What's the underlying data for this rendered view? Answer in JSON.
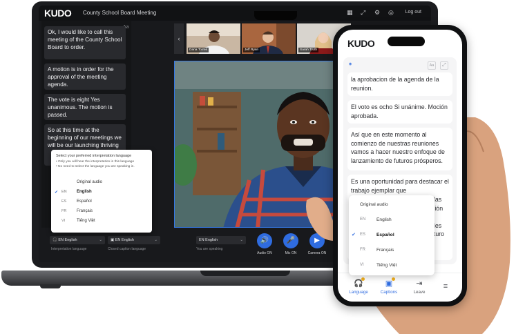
{
  "laptop": {
    "app_logo": "KUDO",
    "meeting_title": "County School Board Meeting",
    "logout": "Log out",
    "captions_font_button": "Aa",
    "captions": [
      "Ok, I would like to call this meeting of the County School Board to order.",
      "A motion is in order for the approval of the meeting agenda.",
      "The vote is eight Yes unanimous. The motion is passed.",
      "So at this time at the beginning of our meetings we will be our launching thriving"
    ],
    "language_popup": {
      "title": "Select your preferred interpretation language",
      "notes": [
        "• Only you will hear the interpretation in this language",
        "• No need to select the language you are speaking in."
      ],
      "options": [
        {
          "code": "",
          "name": "Original audio",
          "selected": false
        },
        {
          "code": "EN",
          "name": "English",
          "selected": true
        },
        {
          "code": "ES",
          "name": "Español",
          "selected": false
        },
        {
          "code": "FR",
          "name": "Français",
          "selected": false
        },
        {
          "code": "VI",
          "name": "Tiếng Việt",
          "selected": false
        }
      ]
    },
    "participants": [
      {
        "name": "Dana Torres"
      },
      {
        "name": "Jeff Ryan"
      },
      {
        "name": "Sarah Truth"
      }
    ],
    "controls": {
      "interpretation_value": "EN English",
      "interpretation_label": "Interpretation language",
      "captions_value": "EN English",
      "captions_label": "Closed caption language",
      "speaking_value": "EN English",
      "speaking_label": "You are speaking",
      "audio_label": "Audio ON",
      "mic_label": "Mic ON",
      "camera_label": "Camera ON"
    }
  },
  "phone": {
    "app_logo": "KUDO",
    "font_button": "Aa",
    "captions": [
      "la aprobacion de la agenda de la reunion.",
      "El voto es ocho Si unánime. Moción aprobada.",
      "Así que en este momento al comienzo de nuestras reuniones vamos a hacer nuestro enfoque de lanzamiento de futuros prósperos.",
      "Es una oportunidad para destacar el trabajo ejemplar que"
    ],
    "caption_tail_fragments": [
      "elas",
      "isión",
      "n",
      "ales",
      "uturo"
    ],
    "language_popup": {
      "options": [
        {
          "code": "",
          "name": "Original audio",
          "selected": false
        },
        {
          "code": "EN",
          "name": "English",
          "selected": false
        },
        {
          "code": "ES",
          "name": "Español",
          "selected": true
        },
        {
          "code": "FR",
          "name": "Français",
          "selected": false
        },
        {
          "code": "VI",
          "name": "Tiếng Việt",
          "selected": false
        }
      ]
    },
    "tabs": {
      "language": "Language",
      "captions": "Captions",
      "leave": "Leave"
    }
  },
  "colors": {
    "accent": "#2f6ce0",
    "badge": "#f2b01e",
    "dark_bg": "#18191c"
  }
}
